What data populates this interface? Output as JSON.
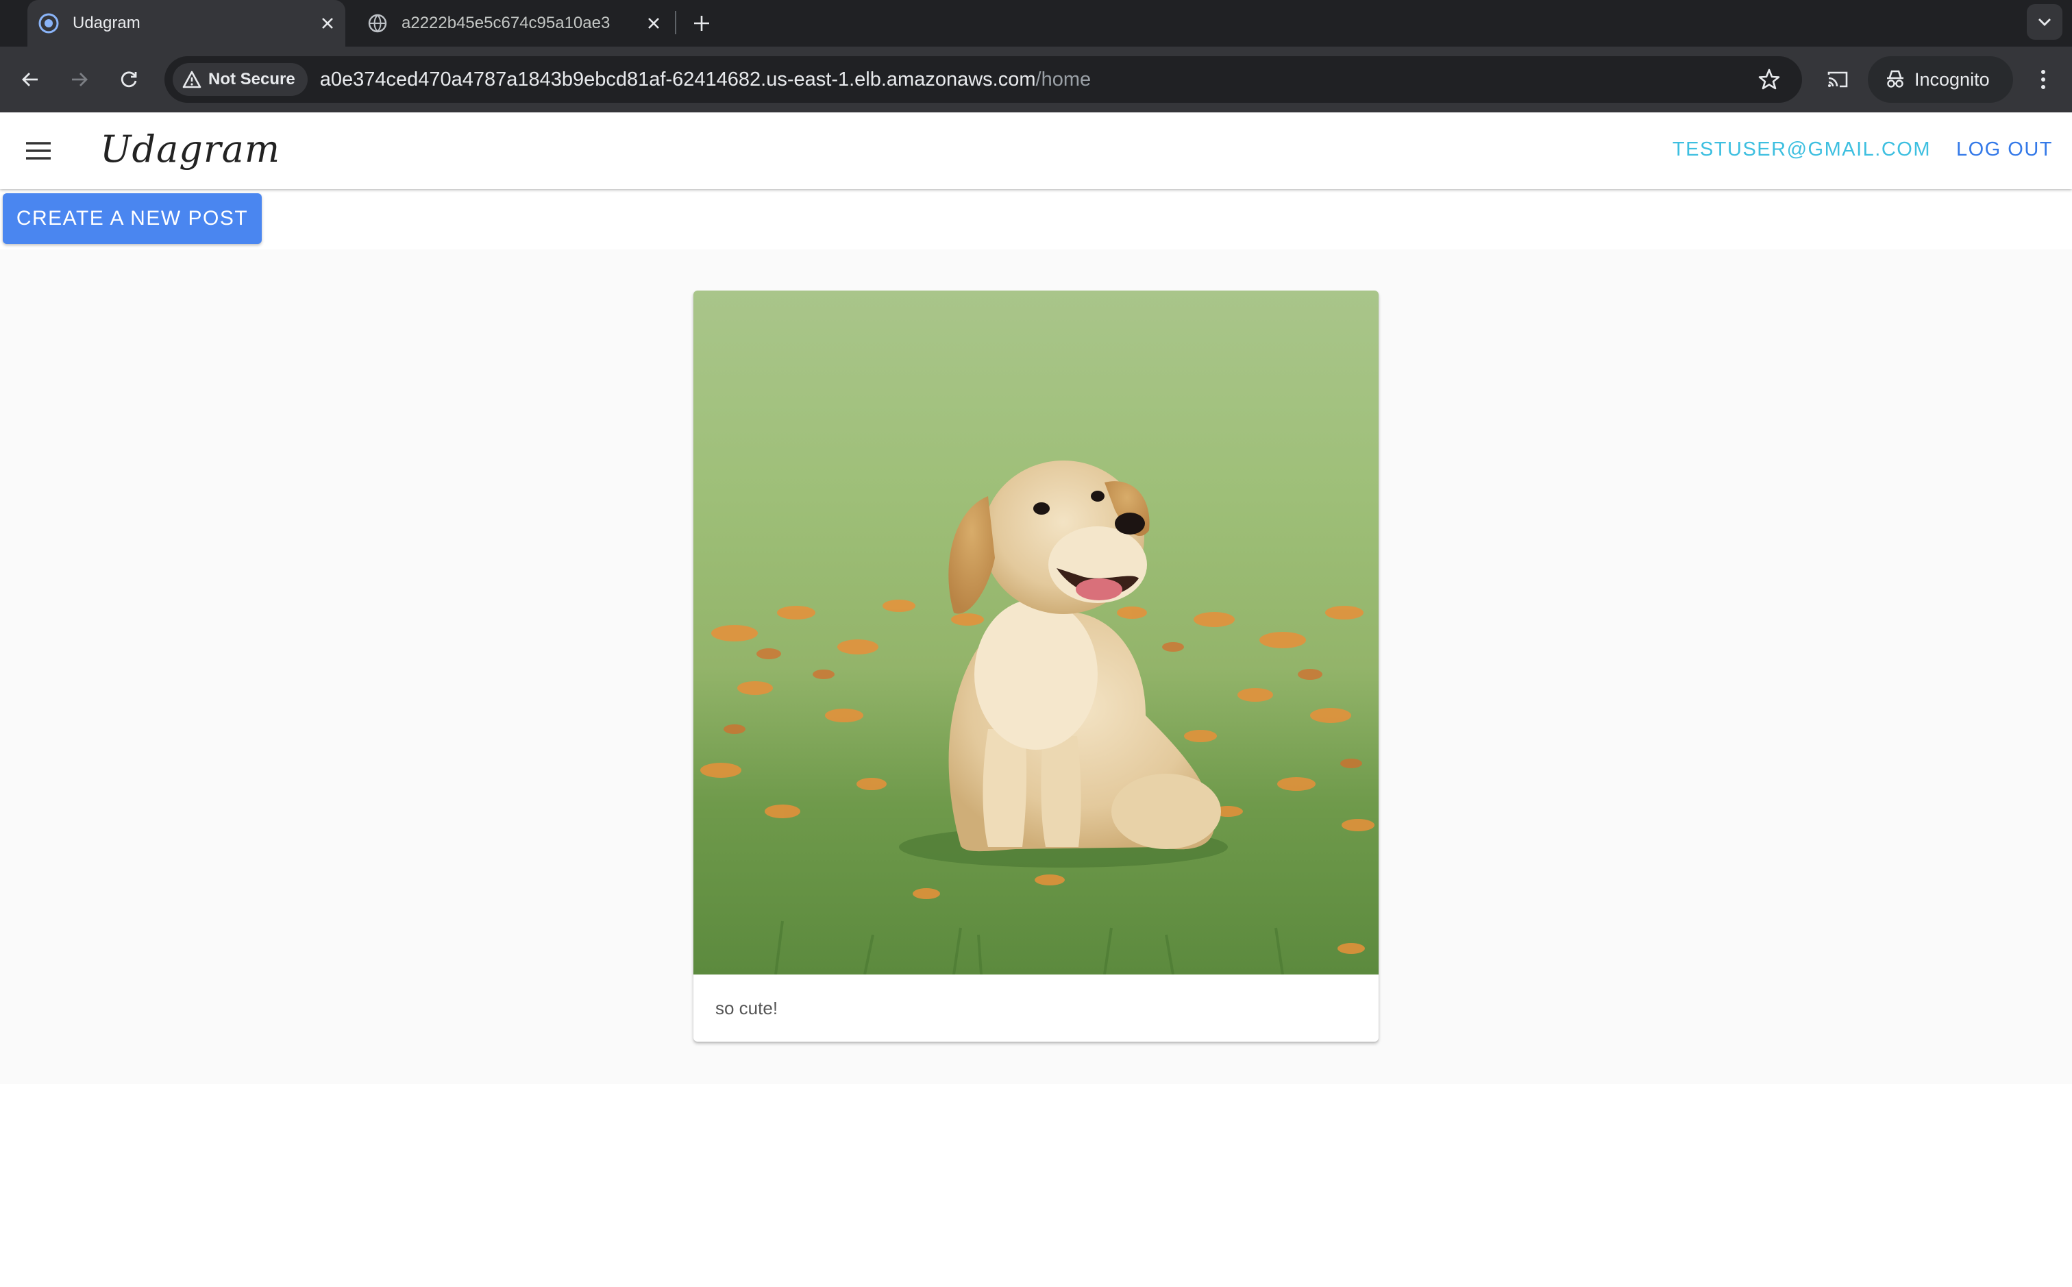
{
  "browser": {
    "tabs": [
      {
        "title": "Udagram",
        "active": true
      },
      {
        "title": "a2222b45e5c674c95a10ae3",
        "active": false
      }
    ],
    "security_chip": "Not Secure",
    "url": {
      "host": "a0e374ced470a4787a1843b9ebcd81af-62414682.us-east-1.elb.amazonaws.com",
      "path": "/home"
    },
    "profile_label": "Incognito",
    "icons": [
      "back-icon",
      "forward-icon",
      "reload-icon",
      "star-icon",
      "cast-icon",
      "incognito-icon",
      "more-icon",
      "new-tab-icon",
      "tab-search-icon"
    ]
  },
  "app": {
    "brand": "Udagram",
    "user_email": "TESTUSER@GMAIL.COM",
    "logout_label": "LOG OUT",
    "create_post_label": "CREATE A NEW POST",
    "colors": {
      "email": "#3dbfe0",
      "logout": "#3479e8",
      "primary_button": "#4a86f0"
    }
  },
  "feed": {
    "posts": [
      {
        "caption": "so cute!",
        "image_subject": "golden retriever puppy sitting in grass with orange flowers"
      }
    ]
  }
}
